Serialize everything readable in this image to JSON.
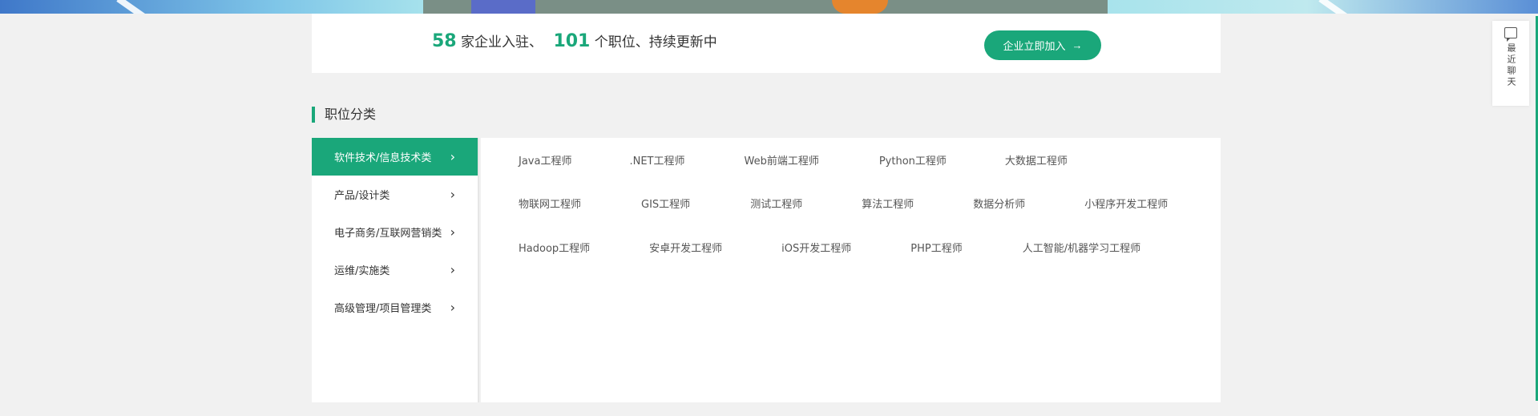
{
  "stats": {
    "company_count": "58",
    "company_text": "家企业入驻、",
    "job_count": "101",
    "job_text": "个职位、持续更新中",
    "join_label": "企业立即加入",
    "join_arrow": "→"
  },
  "section": {
    "title": "职位分类"
  },
  "categories": [
    {
      "label": "软件技术/信息技术类",
      "active": true
    },
    {
      "label": "产品/设计类",
      "active": false
    },
    {
      "label": "电子商务/互联网营销类",
      "active": false
    },
    {
      "label": "运维/实施类",
      "active": false
    },
    {
      "label": "高级管理/项目管理类",
      "active": false
    }
  ],
  "chevron_glyph": "›",
  "jobs": [
    [
      "Java工程师",
      ".NET工程师",
      "Web前端工程师",
      "Python工程师",
      "大数据工程师"
    ],
    [
      "物联网工程师",
      "GIS工程师",
      "测试工程师",
      "算法工程师",
      "数据分析师",
      "小程序开发工程师"
    ],
    [
      "Hadoop工程师",
      "安卓开发工程师",
      "iOS开发工程师",
      "PHP工程师",
      "人工智能/机器学习工程师"
    ]
  ],
  "chat": {
    "label": "最近聊天",
    "icon": "chat-bubble-icon"
  },
  "colors": {
    "accent": "#1aa77a",
    "background": "#f1f1f1"
  }
}
